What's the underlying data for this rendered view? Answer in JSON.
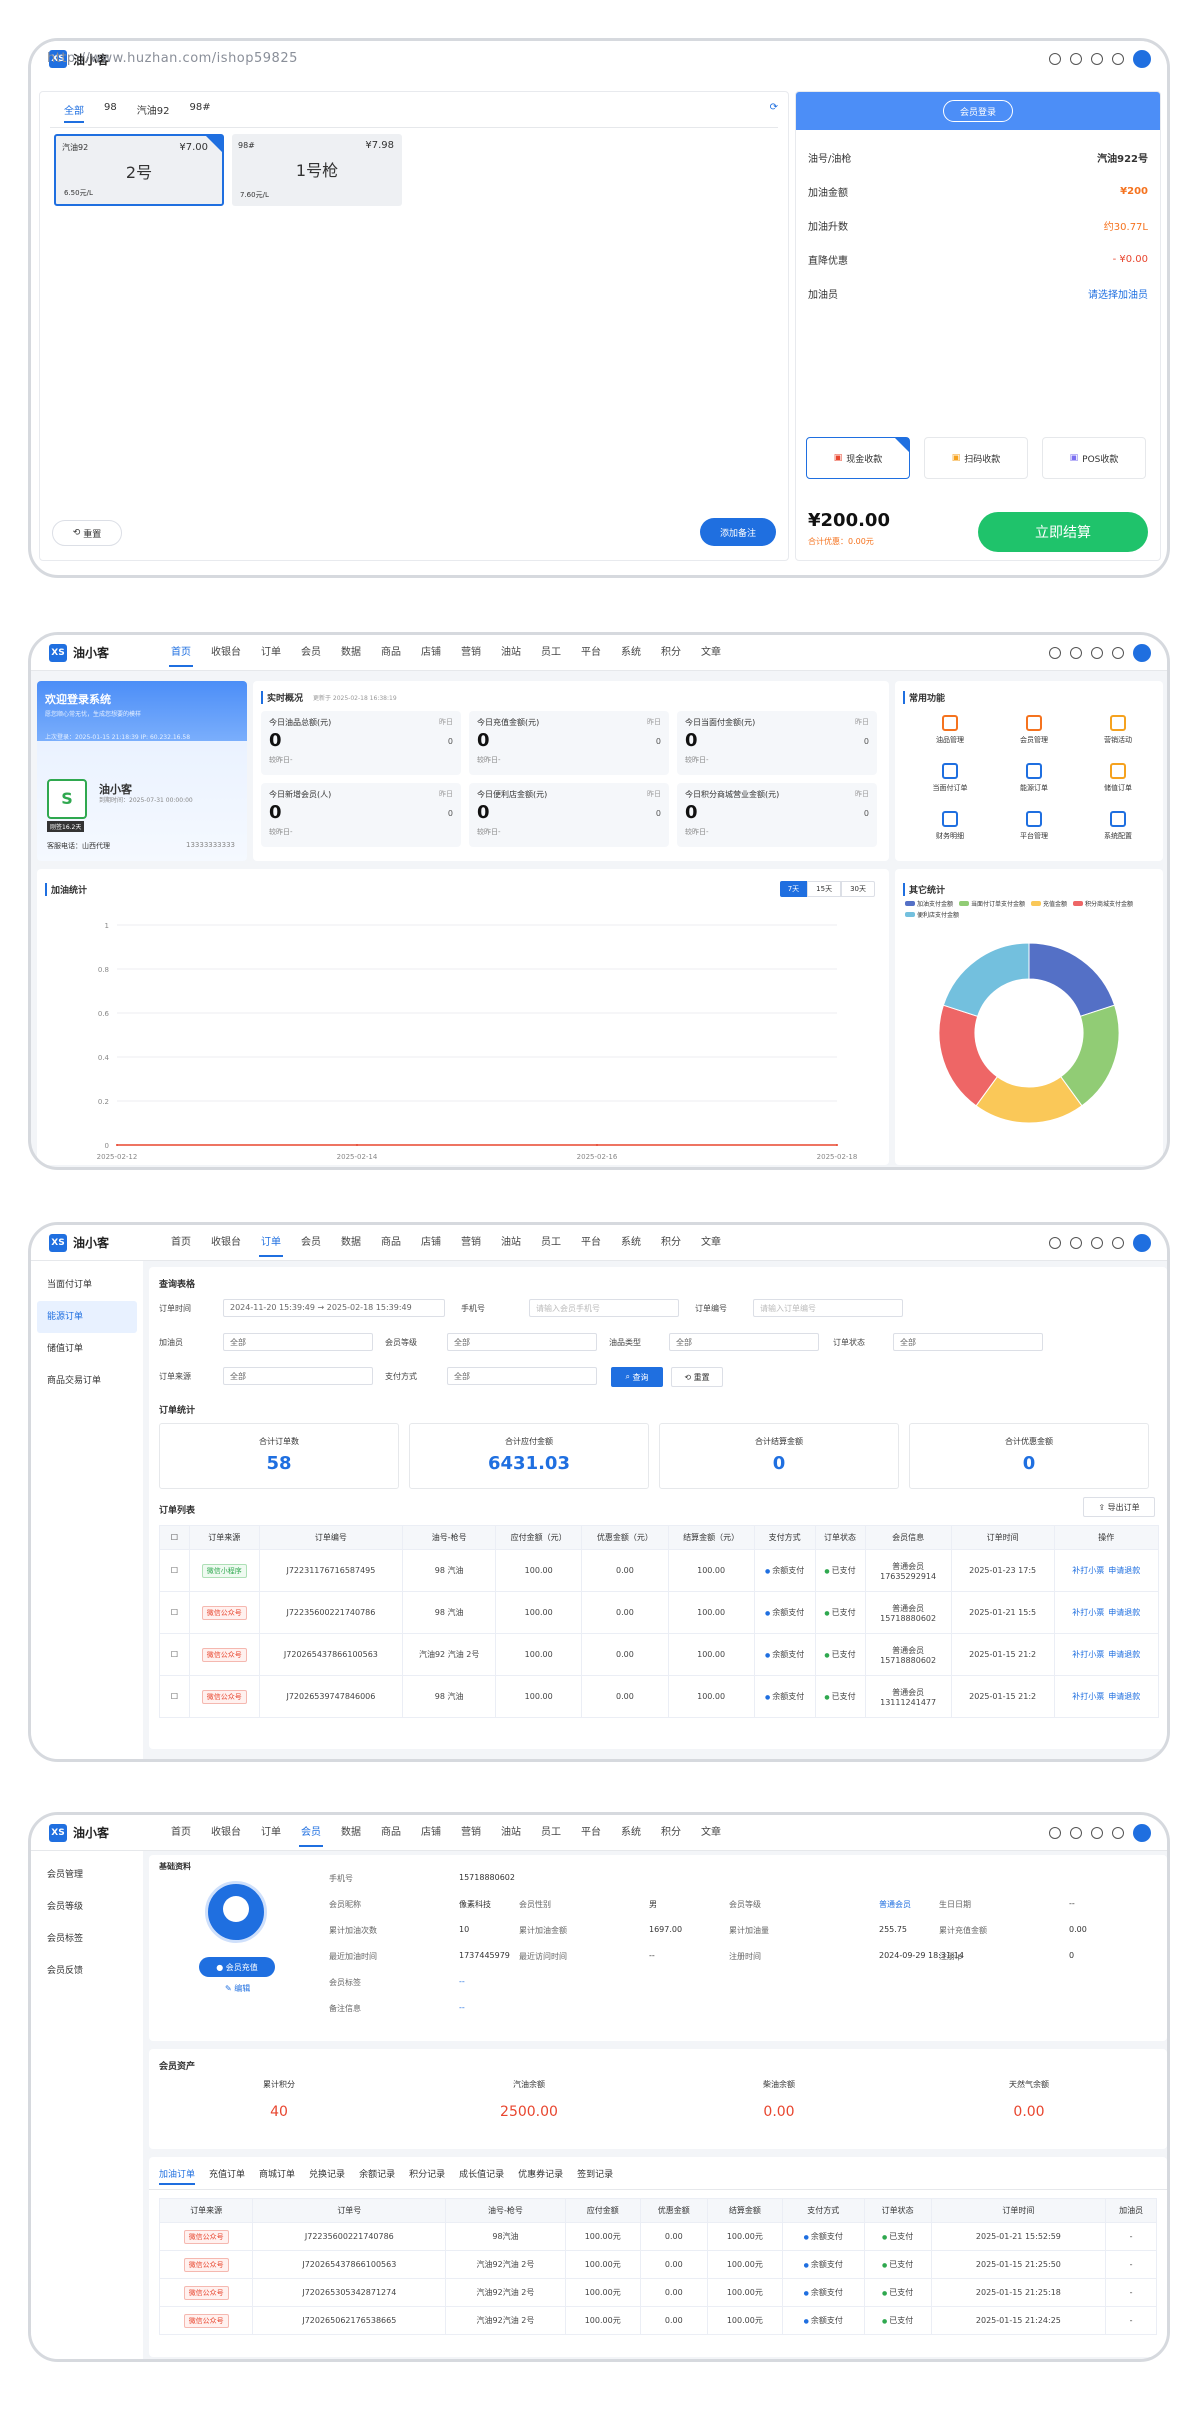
{
  "watermark": "http://www.huzhan.com/ishop59825",
  "app": {
    "name": "油小客",
    "logo": "XS"
  },
  "nav": [
    "首页",
    "收银台",
    "订单",
    "会员",
    "数据",
    "商品",
    "店铺",
    "营销",
    "油站",
    "员工",
    "平台",
    "系统",
    "积分",
    "文章"
  ],
  "pos": {
    "tabs": [
      "全部",
      "98",
      "汽油92",
      "98#"
    ],
    "pumps": [
      {
        "oil": "汽油92",
        "price": "¥7.00",
        "name": "2号",
        "unit": "6.50元/L",
        "selected": true
      },
      {
        "oil": "98#",
        "price": "¥7.98",
        "name": "1号枪",
        "unit": "7.60元/L",
        "selected": false
      }
    ],
    "reset": "重置",
    "add_note": "添加备注",
    "member_login": "会员登录",
    "details": [
      {
        "label": "油号/油枪",
        "value": "汽油922号"
      },
      {
        "label": "加油金额",
        "value": "¥200"
      },
      {
        "label": "加油升数",
        "value": "约30.77L"
      },
      {
        "label": "直降优惠",
        "value": "- ¥0.00"
      },
      {
        "label": "加油员",
        "value": "请选择加油员"
      }
    ],
    "pay_methods": [
      "现金收款",
      "扫码收款",
      "POS收款"
    ],
    "total": "¥200.00",
    "discount": "合计优惠：0.00元",
    "checkout": "立即结算"
  },
  "dashboard": {
    "welcome": "欢迎登录系统",
    "welcome_sub": "愿您顺心常无忧，生成您想要的模样",
    "last_login": "上次登录：2025-01-15 21:18:39 IP: 60.232.16.58",
    "store": "油小客",
    "store_expire": "到期时间：2025-07-31 00:00:00",
    "version": "刚签16.2天",
    "hotline": "客服电话：山西代理",
    "hotline_num": "13333333333",
    "overview_title": "实时概况",
    "overview_time": "更新于 2025-02-18 16:38:19",
    "kpis": [
      {
        "label": "今日油品总额(元)",
        "value": "0",
        "yd": "昨日",
        "yv": "0",
        "cmp": "较昨日-"
      },
      {
        "label": "今日充值金额(元)",
        "value": "0",
        "yd": "昨日",
        "yv": "0",
        "cmp": "较昨日-"
      },
      {
        "label": "今日当面付金额(元)",
        "value": "0",
        "yd": "昨日",
        "yv": "0",
        "cmp": "较昨日-"
      },
      {
        "label": "今日新增会员(人)",
        "value": "0",
        "yd": "昨日",
        "yv": "0",
        "cmp": "较昨日-"
      },
      {
        "label": "今日便利店金额(元)",
        "value": "0",
        "yd": "昨日",
        "yv": "0",
        "cmp": "较昨日-"
      },
      {
        "label": "今日积分商城营业金额(元)",
        "value": "0",
        "yd": "昨日",
        "yv": "0",
        "cmp": "较昨日-"
      }
    ],
    "common_title": "常用功能",
    "common": [
      {
        "label": "油品管理",
        "color": "#f5731f"
      },
      {
        "label": "会员管理",
        "color": "#f5731f"
      },
      {
        "label": "营销活动",
        "color": "#f5a21f"
      },
      {
        "label": "当面付订单",
        "color": "#1f6fe0"
      },
      {
        "label": "能源订单",
        "color": "#1f6fe0"
      },
      {
        "label": "储值订单",
        "color": "#f5a21f"
      },
      {
        "label": "财务明细",
        "color": "#1f6fe0"
      },
      {
        "label": "平台管理",
        "color": "#1f6fe0"
      },
      {
        "label": "系统配置",
        "color": "#1f6fe0"
      }
    ],
    "stats_title": "加油统计",
    "ranges": [
      "7天",
      "15天",
      "30天"
    ],
    "other_title": "其它统计",
    "legend": [
      {
        "label": "加油支付金额",
        "color": "#5470c6"
      },
      {
        "label": "当面付订单支付金额",
        "color": "#91cc75"
      },
      {
        "label": "充值金额",
        "color": "#fac858"
      },
      {
        "label": "积分商城支付金额",
        "color": "#ee6666"
      },
      {
        "label": "便利店支付金额",
        "color": "#73c0de"
      }
    ]
  },
  "chart_data": [
    {
      "type": "line",
      "x": [
        "2025-02-12",
        "2025-02-14",
        "2025-02-16",
        "2025-02-18"
      ],
      "y_ticks": [
        "1",
        "0.8",
        "0.6",
        "0.4",
        "0.2",
        "0"
      ],
      "series": [
        {
          "values": [
            0,
            0,
            0,
            0
          ],
          "color": "#e8462f"
        }
      ],
      "ylim": [
        0,
        1
      ],
      "grid": true
    },
    {
      "type": "pie",
      "labels": [
        "加油支付金额",
        "当面付订单支付金额",
        "充值金额",
        "积分商城支付金额",
        "便利店支付金额"
      ],
      "values": [
        20,
        20,
        20,
        20,
        20
      ],
      "colors": [
        "#5470c6",
        "#91cc75",
        "#fac858",
        "#ee6666",
        "#73c0de"
      ]
    }
  ],
  "orders": {
    "side": [
      "当面付订单",
      "能源订单",
      "储值订单",
      "商品交易订单"
    ],
    "query_title": "查询表格",
    "f_time": "订单时间",
    "f_time_v": "2024-11-20 15:39:49  →  2025-02-18 15:39:49",
    "f_phone": "手机号",
    "f_phone_ph": "请输入会员手机号",
    "f_no": "订单编号",
    "f_no_ph": "请输入订单编号",
    "f_staff": "加油员",
    "f_level": "会员等级",
    "f_oiltype": "油品类型",
    "f_status": "订单状态",
    "f_source": "订单来源",
    "f_pay": "支付方式",
    "all": "全部",
    "search": "查询",
    "reset": "重置",
    "stat_title": "订单统计",
    "stats": [
      {
        "label": "合计订单数",
        "value": "58"
      },
      {
        "label": "合计应付金额",
        "value": "6431.03"
      },
      {
        "label": "合计结算金额",
        "value": "0"
      },
      {
        "label": "合计优惠金额",
        "value": "0"
      }
    ],
    "list_title": "订单列表",
    "export": "导出订单",
    "cols": [
      "订单来源",
      "订单编号",
      "油号-枪号",
      "应付金额（元）",
      "优惠金额（元）",
      "结算金额（元）",
      "支付方式",
      "订单状态",
      "会员信息",
      "订单时间",
      "操作"
    ],
    "rows": [
      {
        "src": "微信小程序",
        "no": "J72231176716587495",
        "gun": "98 汽油",
        "pay": "100.00",
        "disc": "0.00",
        "set": "100.00",
        "way": "余额支付",
        "st": "已支付",
        "mem": "普通会员",
        "phone": "17635292914",
        "time": "2025-01-23 17:5",
        "g": true
      },
      {
        "src": "微信公众号",
        "no": "J72235600221740786",
        "gun": "98 汽油",
        "pay": "100.00",
        "disc": "0.00",
        "set": "100.00",
        "way": "余额支付",
        "st": "已支付",
        "mem": "普通会员",
        "phone": "15718880602",
        "time": "2025-01-21 15:5",
        "g": false
      },
      {
        "src": "微信公众号",
        "no": "J72026543786610056​3",
        "gun": "汽油92 汽油 2号",
        "pay": "100.00",
        "disc": "0.00",
        "set": "100.00",
        "way": "余额支付",
        "st": "已支付",
        "mem": "普通会员",
        "phone": "15718880602",
        "time": "2025-01-15 21:2",
        "g": false
      },
      {
        "src": "微信公众号",
        "no": "J72026539747846006",
        "gun": "98 汽油",
        "pay": "100.00",
        "disc": "0.00",
        "set": "100.00",
        "way": "余额支付",
        "st": "已支付",
        "mem": "普通会员",
        "phone": "13111241477",
        "time": "2025-01-15 21:2",
        "g": false
      }
    ],
    "ops": [
      "补打小票",
      "申请退款"
    ]
  },
  "member": {
    "side": [
      "会员管理",
      "会员等级",
      "会员标签",
      "会员反馈"
    ],
    "basic": "基础资料",
    "recharge": "会员充值",
    "edit": "编辑",
    "fields": [
      [
        "手机号",
        "15718880602",
        "",
        "",
        "",
        "",
        "",
        ""
      ],
      [
        "会员昵称",
        "像素科技",
        "会员性别",
        "男",
        "会员等级",
        "普通会员",
        "生日日期",
        "--"
      ],
      [
        "累计加油次数",
        "10",
        "累计加油金额",
        "1697.00",
        "累计加油量",
        "255.75",
        "累计充值金额",
        "0.00"
      ],
      [
        "最近加油时间",
        "1737445979",
        "最近访问时间",
        "--",
        "注册时间",
        "2024-09-29 18:31:14",
        "注册ip",
        "0"
      ],
      [
        "会员标签",
        "--",
        "",
        "",
        "",
        "",
        "",
        ""
      ],
      [
        "备注信息",
        "--",
        "",
        "",
        "",
        "",
        "",
        ""
      ]
    ],
    "asset_title": "会员资产",
    "assets": [
      {
        "label": "累计积分",
        "value": "40"
      },
      {
        "label": "汽油余额",
        "value": "2500.00"
      },
      {
        "label": "柴油余额",
        "value": "0.00"
      },
      {
        "label": "天然气余额",
        "value": "0.00"
      }
    ],
    "tabs": [
      "加油订单",
      "充值订单",
      "商城订单",
      "兑换记录",
      "余额记录",
      "积分记录",
      "成长值记录",
      "优惠券记录",
      "签到记录"
    ],
    "cols": [
      "订单来源",
      "订单号",
      "油号-枪号",
      "应付金额",
      "优惠金额",
      "结算金额",
      "支付方式",
      "订单状态",
      "订单时间",
      "加油员"
    ],
    "rows": [
      {
        "src": "微信公众号",
        "no": "J72235600221740786",
        "gun": "98汽油",
        "pay": "100.00元",
        "disc": "0.00",
        "set": "100.00元",
        "way": "余额支付",
        "st": "已支付",
        "time": "2025-01-21 15:52:59",
        "staff": "-"
      },
      {
        "src": "微信公众号",
        "no": "J72026543786610056​3",
        "gun": "汽油92汽油 2号",
        "pay": "100.00元",
        "disc": "0.00",
        "set": "100.00元",
        "way": "余额支付",
        "st": "已支付",
        "time": "2025-01-15 21:25:50",
        "staff": "-"
      },
      {
        "src": "微信公众号",
        "no": "J72026530534287127​4",
        "gun": "汽油92汽油 2号",
        "pay": "100.00元",
        "disc": "0.00",
        "set": "100.00元",
        "way": "余额支付",
        "st": "已支付",
        "time": "2025-01-15 21:25:18",
        "staff": "-"
      },
      {
        "src": "微信公众号",
        "no": "J72026506217653866​5",
        "gun": "汽油92汽油 2号",
        "pay": "100.00元",
        "disc": "0.00",
        "set": "100.00元",
        "way": "余额支付",
        "st": "已支付",
        "time": "2025-01-15 21:24:25",
        "staff": "-"
      }
    ]
  }
}
